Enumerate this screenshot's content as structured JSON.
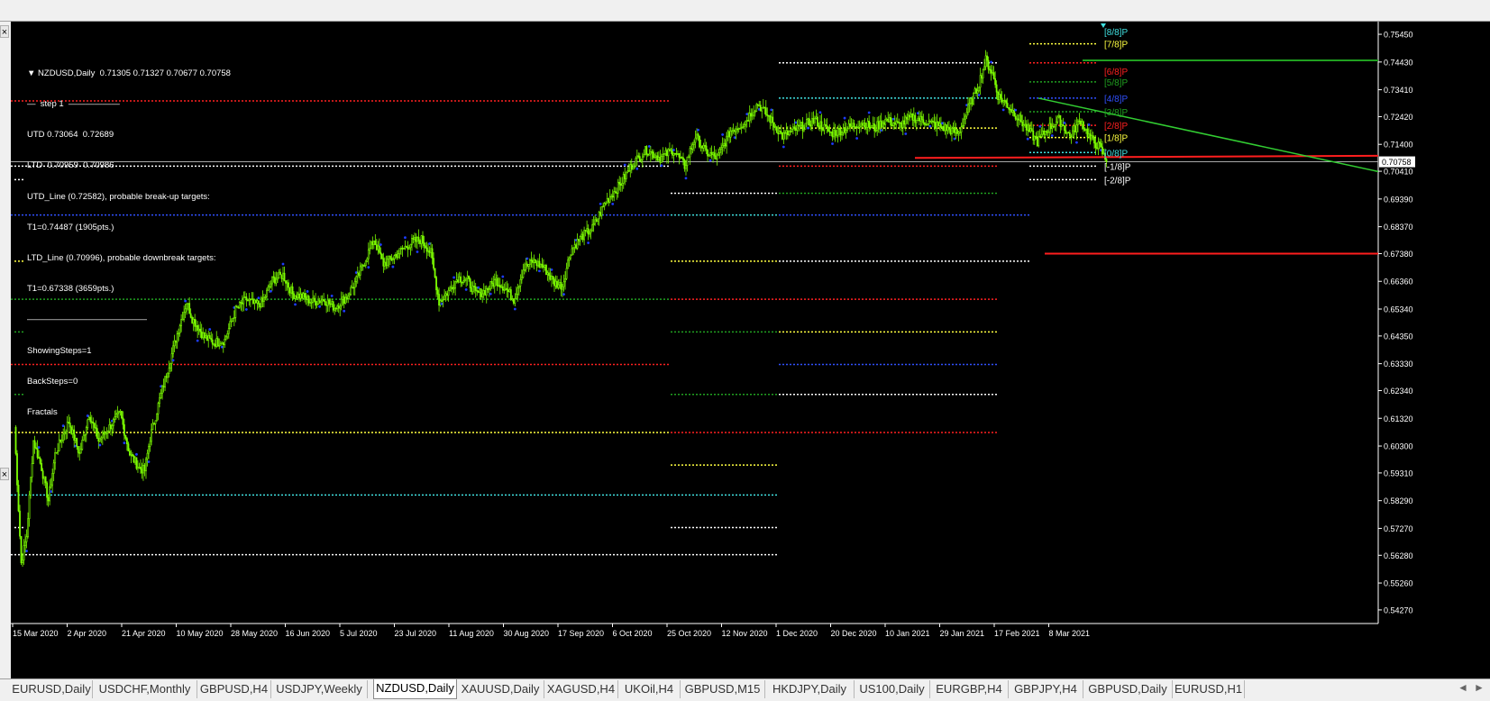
{
  "header": {
    "symbol": "NZDUSD,Daily",
    "ohlc": "0.71305 0.71327 0.70677 0.70758"
  },
  "indicator_text": [
    "—  step 1  ——————",
    "UTD 0.73064  0.72689",
    "LTD  0.70959  0.70986",
    "UTD_Line (0.72582), probable break-up targets:",
    "T1=0.74487 (1905pts.)",
    "LTD_Line (0.70996), probable downbreak targets:",
    "T1=0.67338 (3659pts.)",
    "——————————————",
    "ShowingSteps=1",
    "BackSteps=0",
    "Fractals"
  ],
  "colors": {
    "background": "#000000",
    "candle": "#7CFC00",
    "fractal": "#1E3CFF",
    "price_label_bg": "#ffffff",
    "trendline": "#32CD32",
    "support_red": "#FF1E1E"
  },
  "tabs": [
    "EURUSD,Daily",
    "USDCHF,Monthly",
    "GBPUSD,H4",
    "USDJPY,Weekly",
    "NZDUSD,Daily",
    "XAUUSD,Daily",
    "XAGUSD,H4",
    "UKOil,H4",
    "GBPUSD,M15",
    "HKDJPY,Daily",
    "US100,Daily",
    "EURGBP,H4",
    "GBPJPY,H4",
    "GBPUSD,Daily",
    "EURUSD,H1"
  ],
  "active_tab": "NZDUSD,Daily",
  "chart_data": {
    "type": "candlestick",
    "title": "NZDUSD,Daily",
    "ylim": [
      0.5377,
      0.7575
    ],
    "y_ticks": [
      "0.75450",
      "0.74430",
      "0.73410",
      "0.72420",
      "0.71400",
      "0.70410",
      "0.69390",
      "0.68370",
      "0.67380",
      "0.66360",
      "0.65340",
      "0.64350",
      "0.63330",
      "0.62340",
      "0.61320",
      "0.60300",
      "0.59310",
      "0.58290",
      "0.57270",
      "0.56280",
      "0.55260",
      "0.54270"
    ],
    "x_ticks": [
      "15 Mar 2020",
      "2 Apr 2020",
      "21 Apr 2020",
      "10 May 2020",
      "28 May 2020",
      "16 Jun 2020",
      "5 Jul 2020",
      "23 Jul 2020",
      "11 Aug 2020",
      "30 Aug 2020",
      "17 Sep 2020",
      "6 Oct 2020",
      "25 Oct 2020",
      "12 Nov 2020",
      "1 Dec 2020",
      "20 Dec 2020",
      "10 Jan 2021",
      "29 Jan 2021",
      "17 Feb 2021",
      "8 Mar 2021"
    ],
    "current_price": "0.70758",
    "price_path": [
      [
        0,
        0.61
      ],
      [
        5,
        0.56
      ],
      [
        9,
        0.57
      ],
      [
        14,
        0.605
      ],
      [
        20,
        0.595
      ],
      [
        25,
        0.583
      ],
      [
        30,
        0.6
      ],
      [
        40,
        0.612
      ],
      [
        48,
        0.6
      ],
      [
        55,
        0.615
      ],
      [
        62,
        0.605
      ],
      [
        70,
        0.61
      ],
      [
        78,
        0.615
      ],
      [
        85,
        0.6
      ],
      [
        92,
        0.595
      ],
      [
        96,
        0.594
      ],
      [
        100,
        0.606
      ],
      [
        107,
        0.62
      ],
      [
        115,
        0.635
      ],
      [
        122,
        0.648
      ],
      [
        127,
        0.656
      ],
      [
        131,
        0.65
      ],
      [
        140,
        0.643
      ],
      [
        147,
        0.641
      ],
      [
        155,
        0.642
      ],
      [
        163,
        0.653
      ],
      [
        171,
        0.657
      ],
      [
        177,
        0.655
      ],
      [
        183,
        0.656
      ],
      [
        190,
        0.664
      ],
      [
        198,
        0.666
      ],
      [
        205,
        0.659
      ],
      [
        212,
        0.658
      ],
      [
        220,
        0.656
      ],
      [
        228,
        0.657
      ],
      [
        236,
        0.654
      ],
      [
        245,
        0.658
      ],
      [
        252,
        0.664
      ],
      [
        259,
        0.672
      ],
      [
        265,
        0.679
      ],
      [
        272,
        0.67
      ],
      [
        278,
        0.672
      ],
      [
        285,
        0.675
      ],
      [
        293,
        0.678
      ],
      [
        300,
        0.679
      ],
      [
        307,
        0.674
      ],
      [
        313,
        0.656
      ],
      [
        320,
        0.66
      ],
      [
        327,
        0.665
      ],
      [
        334,
        0.664
      ],
      [
        340,
        0.659
      ],
      [
        347,
        0.66
      ],
      [
        355,
        0.664
      ],
      [
        362,
        0.661
      ],
      [
        368,
        0.657
      ],
      [
        375,
        0.668
      ],
      [
        382,
        0.671
      ],
      [
        390,
        0.669
      ],
      [
        398,
        0.663
      ],
      [
        404,
        0.662
      ],
      [
        410,
        0.675
      ],
      [
        418,
        0.68
      ],
      [
        426,
        0.683
      ],
      [
        436,
        0.693
      ],
      [
        446,
        0.699
      ],
      [
        456,
        0.707
      ],
      [
        466,
        0.712
      ],
      [
        476,
        0.709
      ],
      [
        486,
        0.712
      ],
      [
        494,
        0.706
      ],
      [
        502,
        0.717
      ],
      [
        510,
        0.711
      ],
      [
        518,
        0.709
      ],
      [
        528,
        0.719
      ],
      [
        538,
        0.722
      ],
      [
        548,
        0.729
      ],
      [
        556,
        0.724
      ],
      [
        566,
        0.717
      ],
      [
        578,
        0.72
      ],
      [
        590,
        0.723
      ],
      [
        602,
        0.718
      ],
      [
        614,
        0.72
      ],
      [
        624,
        0.722
      ],
      [
        634,
        0.72
      ],
      [
        642,
        0.723
      ],
      [
        652,
        0.721
      ],
      [
        662,
        0.724
      ],
      [
        674,
        0.722
      ],
      [
        686,
        0.72
      ],
      [
        696,
        0.718
      ],
      [
        702,
        0.726
      ],
      [
        710,
        0.735
      ],
      [
        716,
        0.745
      ],
      [
        721,
        0.74
      ],
      [
        725,
        0.732
      ],
      [
        731,
        0.729
      ],
      [
        738,
        0.725
      ],
      [
        746,
        0.72
      ],
      [
        754,
        0.715
      ],
      [
        762,
        0.72
      ],
      [
        770,
        0.723
      ],
      [
        778,
        0.717
      ],
      [
        786,
        0.723
      ],
      [
        793,
        0.716
      ],
      [
        800,
        0.713
      ],
      [
        805,
        0.7076
      ]
    ],
    "murrey_labels": [
      {
        "label": "[8/8]P",
        "price": 0.7555,
        "color": "#40E0E0"
      },
      {
        "label": "[7/8]P",
        "price": 0.751,
        "color": "#FFFF40"
      },
      {
        "label": "[6/8]P",
        "price": 0.741,
        "color": "#FF2020"
      },
      {
        "label": "[5/8]P",
        "price": 0.737,
        "color": "#20A020"
      },
      {
        "label": "[4/8]P",
        "price": 0.731,
        "color": "#3050FF"
      },
      {
        "label": "[3/8]P",
        "price": 0.726,
        "color": "#20A020"
      },
      {
        "label": "[2/8]P",
        "price": 0.721,
        "color": "#FF2020"
      },
      {
        "label": "[1/8]P",
        "price": 0.7165,
        "color": "#FFFF40"
      },
      {
        "label": "[0/8]P",
        "price": 0.711,
        "color": "#40E0E0"
      },
      {
        "label": "[-1/8]P",
        "price": 0.706,
        "color": "#FFFFFF"
      },
      {
        "label": "[-2/8]P",
        "price": 0.701,
        "color": "#FFFFFF"
      }
    ],
    "grid": false,
    "legend": "none"
  }
}
